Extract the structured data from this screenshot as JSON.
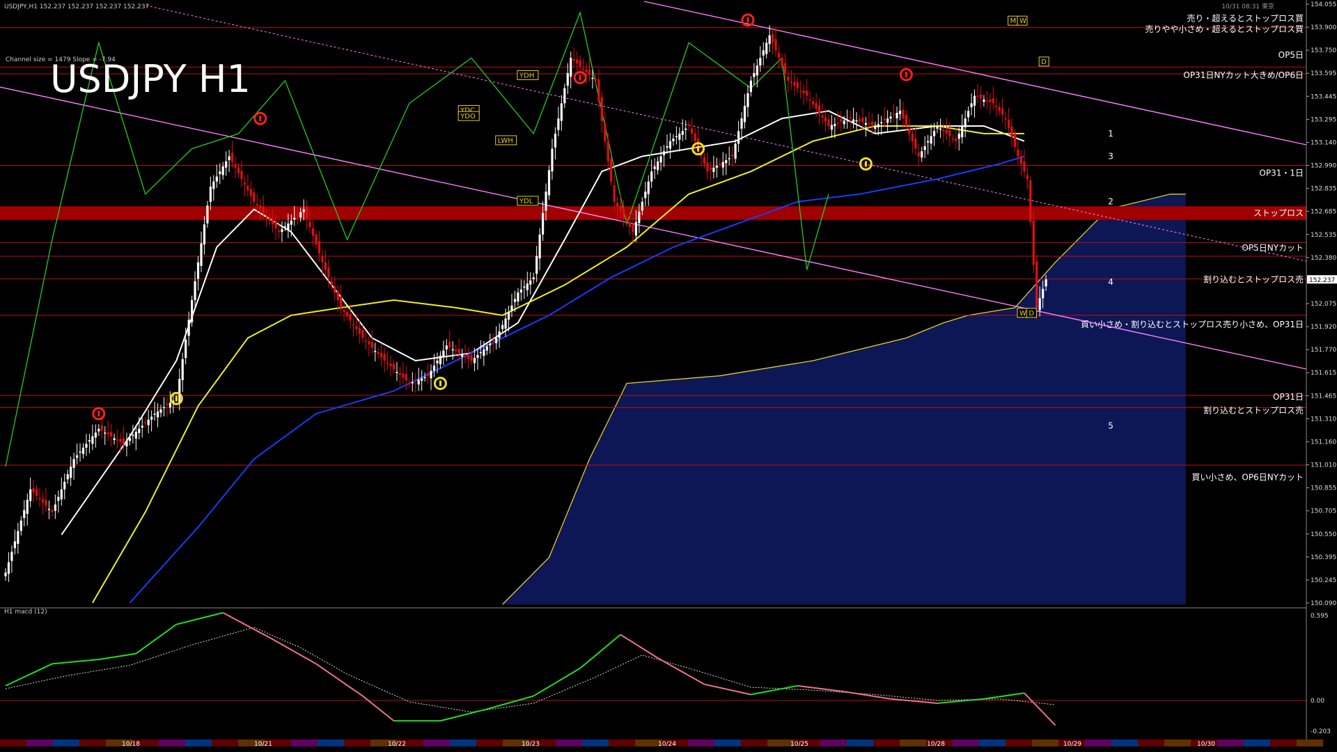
{
  "window": {
    "title": "USDJPY,H1  152.237 152.237 152.237 152.237",
    "symbol_label": "USDJPY H1",
    "channel_info": "Channel size = 1479 Slope = -7.94",
    "corner_time": "10/31 08:31 東京"
  },
  "colors": {
    "background": "#000000",
    "bull_candle": "#ffffff",
    "bear_candle": "#e01010",
    "channel": "#ff80ff",
    "sma_white": "#ffffff",
    "sma_yellow": "#f0f020",
    "sma_blue": "#1a3cff",
    "chikou_green": "#20d020",
    "cloud_blue": "#1a2a9a",
    "level_line": "#c01010",
    "stop_band": "#a00000"
  },
  "chart_data": [
    {
      "type": "candlestick",
      "title": "USDJPY H1",
      "price_axis": {
        "range": [
          150.09,
          154.055
        ],
        "ticks": [
          "154.055",
          "153.900",
          "153.750",
          "153.595",
          "153.445",
          "153.295",
          "153.140",
          "152.990",
          "152.835",
          "152.685",
          "152.535",
          "152.380",
          "152.237",
          "152.075",
          "151.920",
          "151.770",
          "151.615",
          "151.465",
          "151.310",
          "151.160",
          "151.010",
          "150.855",
          "150.705",
          "150.550",
          "150.395",
          "150.245",
          "150.090"
        ],
        "current_price": "152.237"
      },
      "time_axis": {
        "labels": [
          "10/18",
          "10/21",
          "10/22",
          "10/23",
          "10/24",
          "10/25",
          "10/28",
          "10/29",
          "10/30"
        ]
      },
      "close_path": [
        [
          0,
          150.3
        ],
        [
          8,
          150.85
        ],
        [
          15,
          150.7
        ],
        [
          22,
          151.05
        ],
        [
          30,
          151.25
        ],
        [
          38,
          151.15
        ],
        [
          48,
          151.35
        ],
        [
          55,
          151.45
        ],
        [
          60,
          152.1
        ],
        [
          66,
          152.85
        ],
        [
          72,
          153.05
        ],
        [
          80,
          152.75
        ],
        [
          88,
          152.55
        ],
        [
          96,
          152.7
        ],
        [
          102,
          152.35
        ],
        [
          108,
          152.05
        ],
        [
          115,
          151.85
        ],
        [
          122,
          151.7
        ],
        [
          130,
          151.55
        ],
        [
          136,
          151.6
        ],
        [
          142,
          151.8
        ],
        [
          150,
          151.7
        ],
        [
          158,
          151.85
        ],
        [
          165,
          152.15
        ],
        [
          170,
          152.25
        ],
        [
          176,
          153.1
        ],
        [
          182,
          153.7
        ],
        [
          190,
          153.55
        ],
        [
          196,
          152.75
        ],
        [
          202,
          152.55
        ],
        [
          208,
          152.95
        ],
        [
          214,
          153.15
        ],
        [
          220,
          153.25
        ],
        [
          226,
          152.95
        ],
        [
          234,
          153.05
        ],
        [
          240,
          153.55
        ],
        [
          246,
          153.85
        ],
        [
          252,
          153.55
        ],
        [
          258,
          153.45
        ],
        [
          265,
          153.25
        ],
        [
          272,
          153.3
        ],
        [
          280,
          153.25
        ],
        [
          288,
          153.35
        ],
        [
          294,
          153.05
        ],
        [
          300,
          153.25
        ],
        [
          306,
          153.15
        ],
        [
          312,
          153.45
        ],
        [
          318,
          153.4
        ],
        [
          322,
          153.3
        ],
        [
          326,
          153.05
        ],
        [
          329,
          152.9
        ],
        [
          332,
          152.05
        ],
        [
          335,
          152.237
        ]
      ],
      "indicators": [
        {
          "name": "sma_white",
          "path": [
            [
              18,
              150.55
            ],
            [
              40,
              151.2
            ],
            [
              55,
              151.7
            ],
            [
              68,
              152.45
            ],
            [
              80,
              152.7
            ],
            [
              92,
              152.55
            ],
            [
              105,
              152.2
            ],
            [
              118,
              151.85
            ],
            [
              132,
              151.7
            ],
            [
              150,
              151.75
            ],
            [
              165,
              151.95
            ],
            [
              180,
              152.5
            ],
            [
              192,
              152.95
            ],
            [
              205,
              153.05
            ],
            [
              220,
              153.1
            ],
            [
              235,
              153.15
            ],
            [
              250,
              153.3
            ],
            [
              265,
              153.35
            ],
            [
              280,
              153.2
            ],
            [
              300,
              153.25
            ],
            [
              315,
              153.25
            ],
            [
              328,
              153.15
            ]
          ]
        },
        {
          "name": "sma_yellow",
          "path": [
            [
              28,
              150.1
            ],
            [
              45,
              150.7
            ],
            [
              62,
              151.4
            ],
            [
              78,
              151.85
            ],
            [
              92,
              152.0
            ],
            [
              108,
              152.05
            ],
            [
              125,
              152.1
            ],
            [
              145,
              152.05
            ],
            [
              160,
              152.0
            ],
            [
              180,
              152.2
            ],
            [
              200,
              152.45
            ],
            [
              220,
              152.8
            ],
            [
              240,
              152.95
            ],
            [
              260,
              153.15
            ],
            [
              280,
              153.25
            ],
            [
              300,
              153.25
            ],
            [
              315,
              153.2
            ],
            [
              328,
              153.2
            ]
          ]
        },
        {
          "name": "sma_blue",
          "path": [
            [
              40,
              150.1
            ],
            [
              62,
              150.6
            ],
            [
              80,
              151.05
            ],
            [
              100,
              151.35
            ],
            [
              125,
              151.5
            ],
            [
              150,
              151.75
            ],
            [
              175,
              152.0
            ],
            [
              195,
              152.25
            ],
            [
              215,
              152.45
            ],
            [
              235,
              152.6
            ],
            [
              255,
              152.75
            ],
            [
              275,
              152.8
            ],
            [
              300,
              152.9
            ],
            [
              320,
              153.0
            ],
            [
              328,
              153.05
            ]
          ]
        },
        {
          "name": "chikou_green",
          "path": [
            [
              0,
              151.0
            ],
            [
              15,
              152.5
            ],
            [
              30,
              153.8
            ],
            [
              45,
              152.8
            ],
            [
              60,
              153.1
            ],
            [
              75,
              153.2
            ],
            [
              90,
              153.55
            ],
            [
              110,
              152.5
            ],
            [
              130,
              153.4
            ],
            [
              150,
              153.7
            ],
            [
              170,
              153.2
            ],
            [
              185,
              154.0
            ],
            [
              200,
              152.6
            ],
            [
              220,
              153.8
            ],
            [
              240,
              153.5
            ],
            [
              250,
              153.7
            ],
            [
              258,
              152.3
            ],
            [
              265,
              152.8
            ]
          ]
        }
      ],
      "cloud_blue": {
        "path": [
          [
            160,
            150.09
          ],
          [
            175,
            150.4
          ],
          [
            188,
            151.05
          ],
          [
            200,
            151.55
          ],
          [
            230,
            151.6
          ],
          [
            260,
            151.7
          ],
          [
            290,
            151.85
          ],
          [
            302,
            151.95
          ],
          [
            310,
            152.0
          ],
          [
            325,
            152.05
          ],
          [
            338,
            152.35
          ],
          [
            355,
            152.7
          ],
          [
            375,
            152.8
          ],
          [
            380,
            152.8
          ]
        ],
        "floor": 150.09
      }
    },
    {
      "type": "line",
      "title": "H1  macd (12)",
      "y_ticks": [
        "0.595",
        "0.00",
        "-0.203"
      ],
      "y_range": [
        -0.22,
        0.6
      ],
      "series": [
        {
          "name": "macd",
          "path": [
            [
              0,
              0.1
            ],
            [
              15,
              0.25
            ],
            [
              30,
              0.28
            ],
            [
              42,
              0.32
            ],
            [
              55,
              0.52
            ],
            [
              70,
              0.6
            ],
            [
              85,
              0.43
            ],
            [
              100,
              0.25
            ],
            [
              115,
              0.03
            ],
            [
              125,
              -0.14
            ],
            [
              140,
              -0.14
            ],
            [
              155,
              -0.06
            ],
            [
              170,
              0.03
            ],
            [
              185,
              0.22
            ],
            [
              198,
              0.45
            ],
            [
              210,
              0.29
            ],
            [
              225,
              0.11
            ],
            [
              240,
              0.04
            ],
            [
              255,
              0.1
            ],
            [
              270,
              0.06
            ],
            [
              285,
              0.01
            ],
            [
              300,
              -0.02
            ],
            [
              315,
              0.01
            ],
            [
              328,
              0.05
            ],
            [
              338,
              -0.17
            ]
          ]
        },
        {
          "name": "signal",
          "path": [
            [
              0,
              0.08
            ],
            [
              20,
              0.17
            ],
            [
              40,
              0.24
            ],
            [
              60,
              0.38
            ],
            [
              80,
              0.5
            ],
            [
              95,
              0.36
            ],
            [
              110,
              0.18
            ],
            [
              130,
              -0.01
            ],
            [
              150,
              -0.08
            ],
            [
              170,
              -0.02
            ],
            [
              190,
              0.16
            ],
            [
              205,
              0.31
            ],
            [
              220,
              0.22
            ],
            [
              240,
              0.09
            ],
            [
              260,
              0.07
            ],
            [
              280,
              0.04
            ],
            [
              300,
              0.0
            ],
            [
              320,
              0.01
            ],
            [
              338,
              -0.03
            ]
          ]
        }
      ]
    }
  ],
  "price_labels": [
    {
      "text": "売り・超えるとストップロス買",
      "price": 153.96
    },
    {
      "text": "売りやや小さめ・超えるとストップロス買",
      "price": 153.89
    },
    {
      "text": "OP5日",
      "price": 153.72
    },
    {
      "text": "OP31日NYカット大きめ/OP6日",
      "price": 153.585
    },
    {
      "text": "OP31・1日",
      "price": 152.94
    },
    {
      "text": "ストップロス",
      "price": 152.675
    },
    {
      "text": "OP5日NYカット",
      "price": 152.445
    },
    {
      "text": "割り込むとストップロス売",
      "price": 152.235
    },
    {
      "text": "買い小さめ・割り込むとストップロス売り小さめ、OP31日",
      "price": 151.94
    },
    {
      "text": "OP31日",
      "price": 151.46
    },
    {
      "text": "割り込むとストップロス売",
      "price": 151.37
    },
    {
      "text": "買い小さめ、OP6日NYカット",
      "price": 150.93
    }
  ],
  "level_lines": [
    153.9,
    153.64,
    153.595,
    152.99,
    152.48,
    152.39,
    152.24,
    152.0,
    151.47,
    151.39,
    151.01
  ],
  "stop_band": {
    "top": 152.72,
    "bottom": 152.63
  },
  "tag_labels": [
    {
      "text": "YDH",
      "idx": 165,
      "price": 153.57
    },
    {
      "text": "YDC",
      "idx": 146,
      "price": 153.34
    },
    {
      "text": "YDO",
      "idx": 146,
      "price": 153.3
    },
    {
      "text": "LWH",
      "idx": 158,
      "price": 153.14
    },
    {
      "text": "YDL",
      "idx": 165,
      "price": 152.74
    },
    {
      "text": "D",
      "idx": 333,
      "price": 153.66
    },
    {
      "text": "M",
      "idx": 323,
      "price": 153.93
    },
    {
      "text": "W",
      "idx": 326,
      "price": 153.93
    },
    {
      "text": "W",
      "idx": 326,
      "price": 152.0
    },
    {
      "text": "D",
      "idx": 329,
      "price": 152.0
    }
  ],
  "wave_labels": [
    {
      "text": "1",
      "idx": 355,
      "price": 153.2
    },
    {
      "text": "2",
      "idx": 355,
      "price": 152.75
    },
    {
      "text": "3",
      "idx": 355,
      "price": 153.05
    },
    {
      "text": "4",
      "idx": 355,
      "price": 152.22
    },
    {
      "text": "5",
      "idx": 355,
      "price": 151.27
    }
  ],
  "arrow_marks": [
    {
      "kind": "sell",
      "idx": 30,
      "price": 151.35
    },
    {
      "kind": "buy",
      "idx": 55,
      "price": 151.45
    },
    {
      "kind": "sell",
      "idx": 82,
      "price": 153.3
    },
    {
      "kind": "buy",
      "idx": 140,
      "price": 151.55
    },
    {
      "kind": "sell",
      "idx": 185,
      "price": 153.57
    },
    {
      "kind": "buy",
      "idx": 223,
      "price": 153.1
    },
    {
      "kind": "sell",
      "idx": 239,
      "price": 153.95
    },
    {
      "kind": "buy",
      "idx": 277,
      "price": 153.0
    },
    {
      "kind": "sell",
      "idx": 290,
      "price": 153.59
    }
  ]
}
